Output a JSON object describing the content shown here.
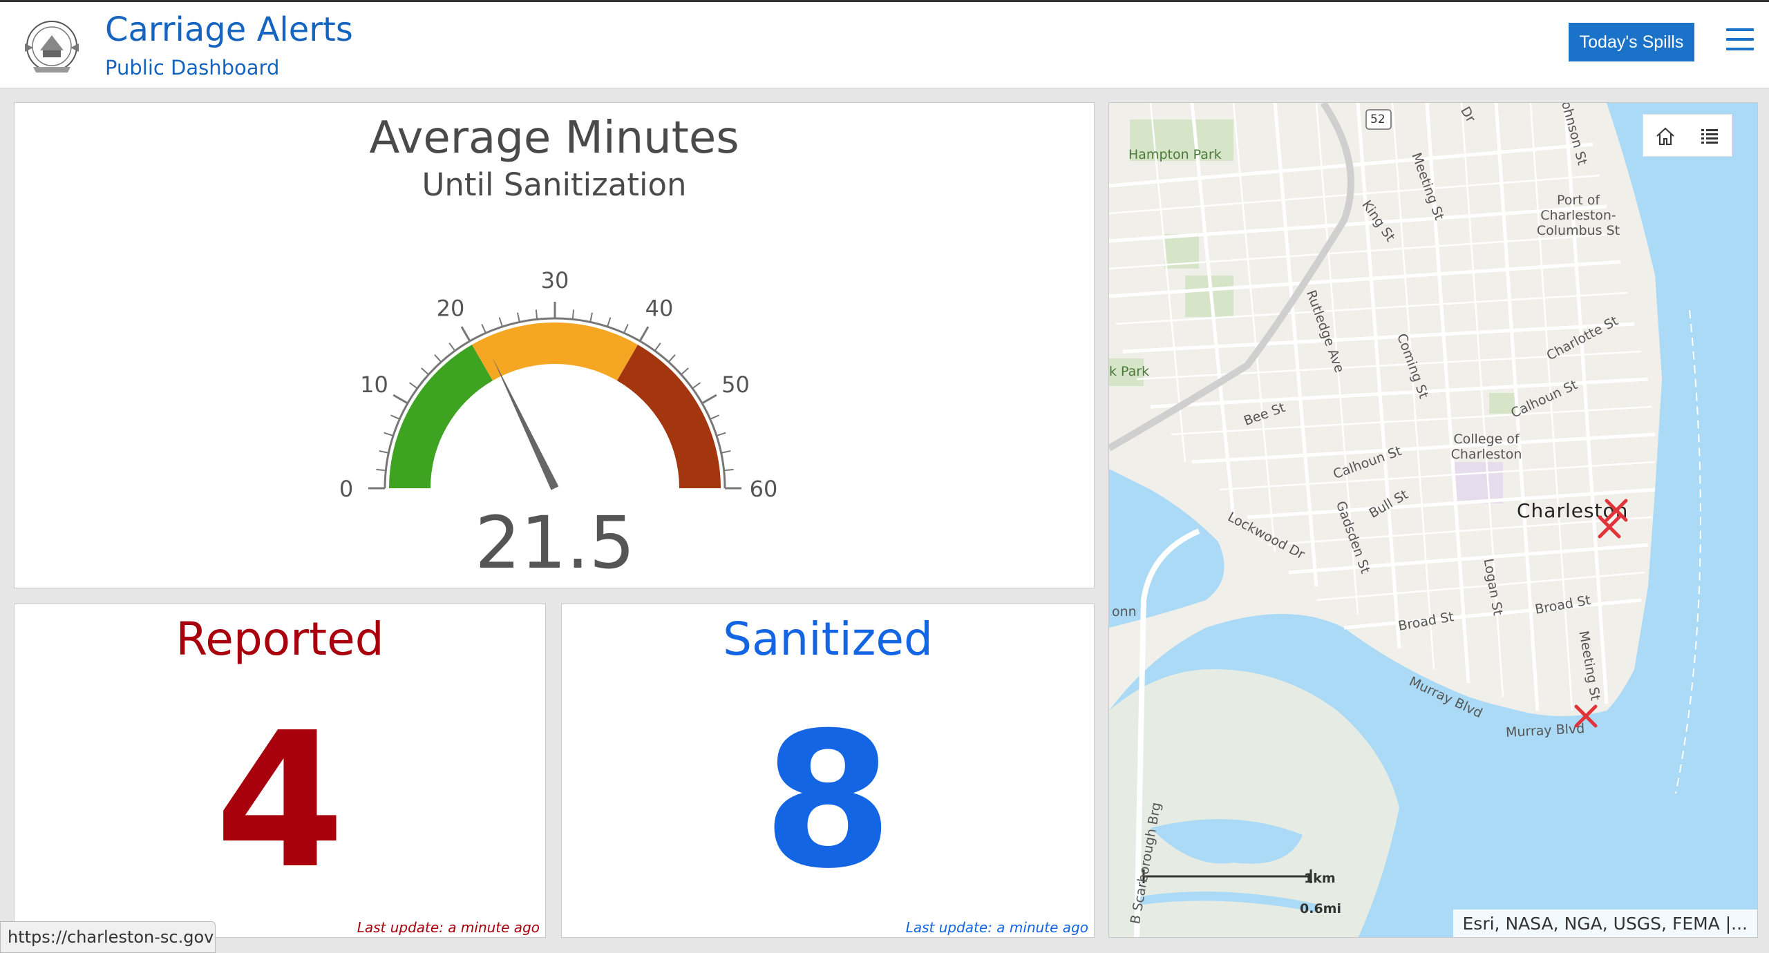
{
  "header": {
    "title": "Carriage Alerts",
    "subtitle": "Public Dashboard",
    "spills_button": "Today's Spills",
    "menu_icon": "hamburger-menu-icon",
    "accent_color": "#1565c0"
  },
  "gauge": {
    "title": "Average Minutes",
    "subtitle": "Until Sanitization",
    "value": 21.5,
    "value_label": "21.5",
    "min": 0,
    "max": 60,
    "tick_labels": [
      "0",
      "10",
      "20",
      "30",
      "40",
      "50",
      "60"
    ],
    "bands": [
      {
        "from": 0,
        "to": 20,
        "color": "#3da321"
      },
      {
        "from": 20,
        "to": 40,
        "color": "#f5a623"
      },
      {
        "from": 40,
        "to": 60,
        "color": "#a3360f"
      }
    ]
  },
  "reported": {
    "title": "Reported",
    "value": "4",
    "last_update": "Last update: a minute ago",
    "color": "#a8000c"
  },
  "sanitized": {
    "title": "Sanitized",
    "value": "8",
    "last_update": "Last update: a minute ago",
    "color": "#1465e3"
  },
  "map": {
    "labels": {
      "hampton_park": "Hampton Park",
      "park_partial": "k Park",
      "route_shield": "52",
      "meeting_st": "Meeting St",
      "king_st": "King St",
      "rutledge_ave": "Rutledge Ave",
      "coming_st": "Coming St",
      "bee_st": "Bee St",
      "calhoun_st": "Calhoun St",
      "calhoun_st_2": "Calhoun St",
      "bull_st": "Bull St",
      "gadsden_st": "Gadsden St",
      "lockwood_dr": "Lockwood Dr",
      "charlotte_st": "Charlotte St",
      "college": "College of Charleston",
      "port": "Port of Charleston-Columbus St",
      "charleston": "Charleston",
      "logan_st": "Logan St",
      "broad_st": "Broad St",
      "broad_st_2": "Broad St",
      "meeting_st_2": "Meeting St",
      "murray_blvd": "Murray Blvd",
      "murray_blvd_2": "Murray Blvd",
      "johnson_st": "Johnson St",
      "dr_partial": "Dr",
      "onn_partial": "onn",
      "scarborough": "B Scarborough Brg",
      "scale_km": "1km",
      "scale_mi": "0.6mi"
    },
    "attribution": "Esri, NASA, NGA, USGS, FEMA |...",
    "marker_icon": "spill-marker-x-icon",
    "marker_color": "#e0333a",
    "tools": [
      "home-icon",
      "legend-list-icon"
    ]
  },
  "status_bar": {
    "url": "https://charleston-sc.gov"
  }
}
